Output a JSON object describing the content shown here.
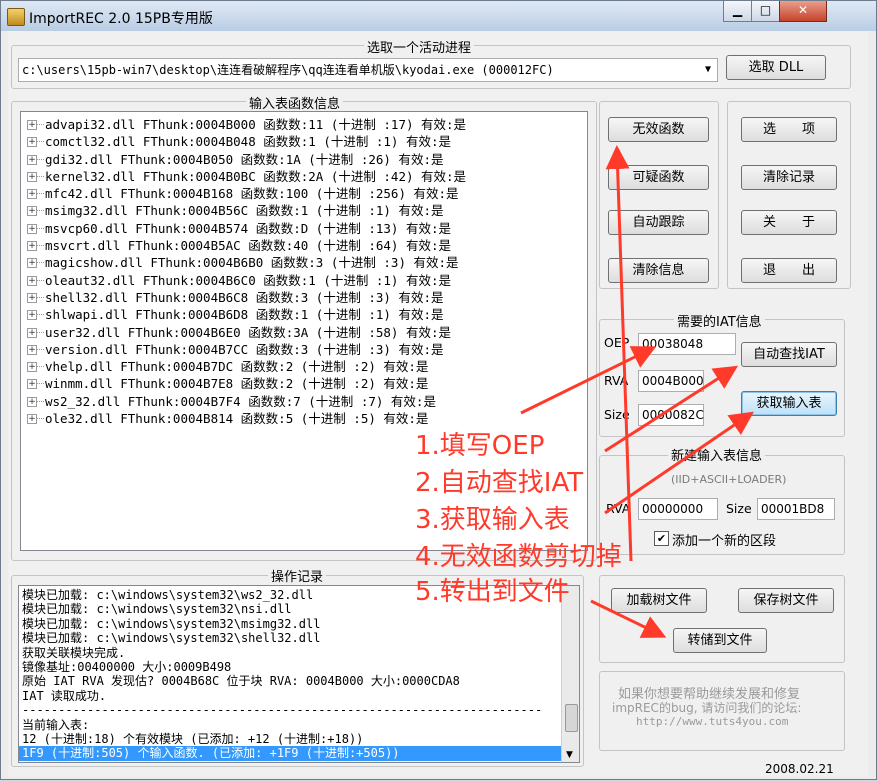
{
  "window": {
    "title": "ImportREC 2.0 15PB专用版",
    "min": "▁",
    "max": "□",
    "close": "✕"
  },
  "process": {
    "group": "选取一个活动进程",
    "selected": "c:\\users\\15pb-win7\\desktop\\连连看破解程序\\qq连连看单机版\\kyodai.exe (000012FC)",
    "pick_dll": "选取 DLL"
  },
  "imports": {
    "group": "输入表函数信息",
    "rows": [
      "advapi32.dll FThunk:0004B000 函数数:11 (十进制 :17) 有效:是",
      "comctl32.dll FThunk:0004B048 函数数:1 (十进制 :1) 有效:是",
      "gdi32.dll FThunk:0004B050 函数数:1A (十进制 :26) 有效:是",
      "kernel32.dll FThunk:0004B0BC 函数数:2A (十进制 :42) 有效:是",
      "mfc42.dll FThunk:0004B168 函数数:100 (十进制 :256) 有效:是",
      "msimg32.dll FThunk:0004B56C 函数数:1 (十进制 :1) 有效:是",
      "msvcp60.dll FThunk:0004B574 函数数:D (十进制 :13) 有效:是",
      "msvcrt.dll FThunk:0004B5AC 函数数:40 (十进制 :64) 有效:是",
      "magicshow.dll FThunk:0004B6B0 函数数:3 (十进制 :3) 有效:是",
      "oleaut32.dll FThunk:0004B6C0 函数数:1 (十进制 :1) 有效:是",
      "shell32.dll FThunk:0004B6C8 函数数:3 (十进制 :3) 有效:是",
      "shlwapi.dll FThunk:0004B6D8 函数数:1 (十进制 :1) 有效:是",
      "user32.dll FThunk:0004B6E0 函数数:3A (十进制 :58) 有效:是",
      "version.dll FThunk:0004B7CC 函数数:3 (十进制 :3) 有效:是",
      "vhelp.dll FThunk:0004B7DC 函数数:2 (十进制 :2) 有效:是",
      "winmm.dll FThunk:0004B7E8 函数数:2 (十进制 :2) 有效:是",
      "ws2_32.dll FThunk:0004B7F4 函数数:7 (十进制 :7) 有效:是",
      "ole32.dll FThunk:0004B814 函数数:5 (十进制 :5) 有效:是"
    ]
  },
  "left_buttons": [
    "无效函数",
    "可疑函数",
    "自动跟踪",
    "清除信息"
  ],
  "right_buttons": [
    "选　　项",
    "清除记录",
    "关　　于",
    "退　　出"
  ],
  "iat": {
    "group": "需要的IAT信息",
    "oep_label": "OEP",
    "oep": "00038048",
    "rva_label": "RVA",
    "rva": "0004B000",
    "size_label": "Size",
    "size": "0000082C",
    "auto_btn": "自动查找IAT",
    "get_btn": "获取输入表"
  },
  "newimp": {
    "group": "新建输入表信息",
    "sub": "(IID+ASCII+LOADER)",
    "rva_label": "RVA",
    "rva": "00000000",
    "size_label": "Size",
    "size": "00001BD8",
    "checkbox": "添加一个新的区段",
    "checked": true
  },
  "log": {
    "group": "操作记录",
    "lines": [
      "模块已加载: c:\\windows\\system32\\ws2_32.dll",
      "模块已加载: c:\\windows\\system32\\nsi.dll",
      "模块已加载: c:\\windows\\system32\\msimg32.dll",
      "模块已加载: c:\\windows\\system32\\shell32.dll",
      "获取关联模块完成.",
      "镜像基址:00400000 大小:0009B498",
      "原始 IAT RVA 发现估? 0004B68C 位于块 RVA: 0004B000 大小:0000CDA8",
      "IAT 读取成功.",
      "------------------------------------------------------------------------",
      "当前输入表:",
      "12 (十进制:18) 个有效模块 (已添加: +12 (十进制:+18))",
      "1F9 (十进制:505) 个输入函数. (已添加: +1F9 (十进制:+505))"
    ]
  },
  "tree_buttons": {
    "load": "加载树文件",
    "save": "保存树文件",
    "dump": "转储到文件"
  },
  "credits": {
    "l1": "如果你想要帮助继续发展和修复",
    "l2": "impREC的bug, 请访问我们的论坛:",
    "l3": "http://www.tuts4you.com"
  },
  "date": "2008.02.21",
  "annotations": [
    "1.填写OEP",
    "2.自动查找IAT",
    "3.获取输入表",
    "4.无效函数剪切掉",
    "5.转出到文件"
  ],
  "colors": {
    "annotation": "#ff3a2a",
    "selection": "#3399ff"
  }
}
